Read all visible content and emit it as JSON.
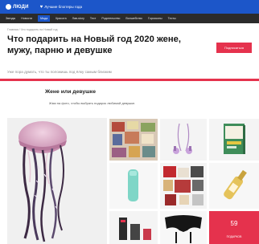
{
  "header": {
    "logo_text": "ЛЮДИ",
    "promo_label": "Лучшие блоггеры года"
  },
  "nav": {
    "items": [
      {
        "label": "Звезды",
        "active": false
      },
      {
        "label": "Новости",
        "active": false
      },
      {
        "label": "Мода",
        "active": true
      },
      {
        "label": "Красота",
        "active": false
      },
      {
        "label": "Лав-story",
        "active": false
      },
      {
        "label": "Тест",
        "active": false
      },
      {
        "label": "Родительство",
        "active": false
      },
      {
        "label": "Волшебство",
        "active": false
      },
      {
        "label": "Гороскопы",
        "active": false
      },
      {
        "label": "Тесты",
        "active": false
      }
    ]
  },
  "article": {
    "breadcrumb": "Главная / Что подарить на Новый год",
    "title": "Что подарить на Новый год 2020 жене, мужу, парню и девушке",
    "lead": "Уже пора думать, что ты положишь под ёлку самым близким",
    "subscribe_label": "Подписаться"
  },
  "section": {
    "title": "Жене или девушке",
    "description": "Жми на фото, чтобы выбрать подарок любимой девушке."
  },
  "gallery": {
    "counter_value": "59",
    "counter_label": "ПОДАРКОВ"
  },
  "colors": {
    "brand_blue": "#1c56c9",
    "nav_dark": "#2b2b2b",
    "accent_red": "#e5324d"
  }
}
